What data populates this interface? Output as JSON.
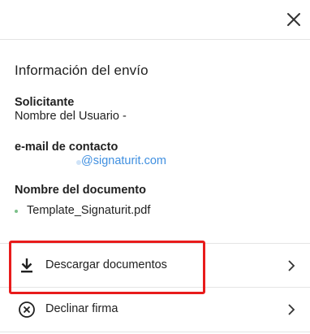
{
  "header": {
    "close_icon": "close-icon"
  },
  "info": {
    "title": "Información del envío",
    "requester_label": "Solicitante",
    "requester_value": "Nombre del Usuario -",
    "email_label": "e-mail de contacto",
    "email_value": "@signaturit.com",
    "document_label": "Nombre del documento",
    "documents": [
      "Template_Signaturit.pdf"
    ]
  },
  "actions": {
    "download": {
      "label": "Descargar documentos",
      "icon": "download-icon",
      "chevron": "chevron-right-icon"
    },
    "decline": {
      "label": "Declinar firma",
      "icon": "circle-x-icon",
      "chevron": "chevron-right-icon"
    }
  },
  "colors": {
    "link": "#3f8fe0",
    "highlight": "#e81b1b",
    "bullet": "#7cc08a",
    "divider": "#e4e4e4"
  }
}
